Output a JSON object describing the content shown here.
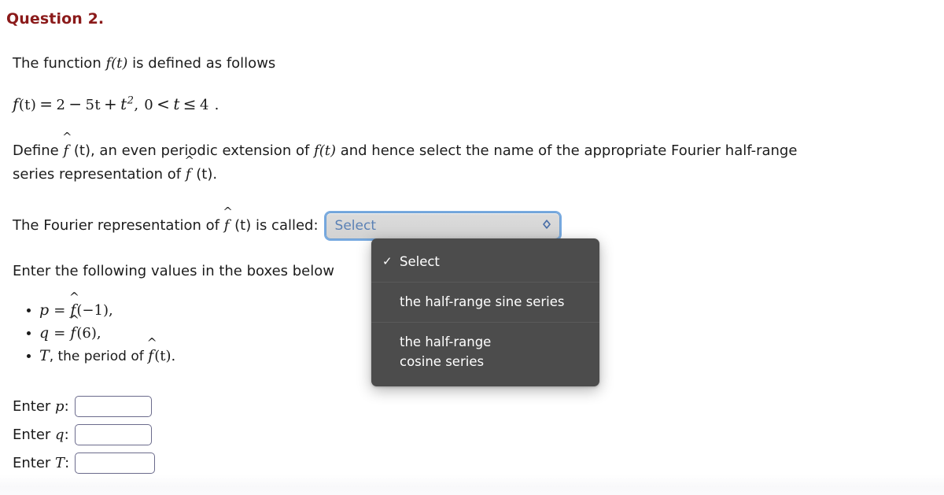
{
  "question": {
    "title": "Question 2."
  },
  "body": {
    "intro_prefix": "The function ",
    "intro_math": "f(t)",
    "intro_suffix": " is defined as follows",
    "formula": "f(t) = 2 − 5t + t², 0 < t ≤ 4 .",
    "formula_parts": {
      "lhs": "f",
      "arg": "(t)",
      "equals": "=",
      "term1": "2",
      "minus": "−",
      "term2": "5t",
      "plus": "+",
      "term3": "t",
      "exponent": "2",
      "comma": ",",
      "domain_low": "0",
      "lt": "<",
      "var": "t",
      "le": "≤",
      "domain_high": "4",
      "period": "."
    },
    "define_line_1": "Define f̂ (t), an even periodic extension of f(t) and hence select the name of the appropriate Fourier half-range",
    "define_line_2": "series representation of f̂ (t).",
    "define_segments": {
      "s1": "Define ",
      "s2": " (t), an even periodic extension of ",
      "s3": "f(t)",
      "s4": " and hence select the name of the appropriate Fourier half-range",
      "s5": "series representation of ",
      "s6": " (t)."
    },
    "fourier_prompt_prefix": "The Fourier representation of ",
    "fourier_prompt_suffix": " (t) is called:",
    "enter_values_line": "Enter the following values in the boxes below"
  },
  "bullets": [
    {
      "symbol": "p",
      "equals": "=",
      "fn": "f̂",
      "arg": "(−1),",
      "trailing": ""
    },
    {
      "symbol": "q",
      "equals": "=",
      "fn": "f̂",
      "arg": "(6),",
      "trailing": ""
    },
    {
      "symbol": "T",
      "equals": "",
      "fn": "f̂",
      "arg": "(t).",
      "trailing": ", the period of "
    }
  ],
  "select": {
    "name": "fourier-representation-select",
    "value": "Select",
    "icon": "stepper-updown-icon",
    "options": [
      {
        "label": "Select",
        "selected": true,
        "check": "✓"
      },
      {
        "label": "the half-range sine series",
        "selected": false,
        "check": ""
      },
      {
        "label": "the half-range cosine series",
        "selected": false,
        "check": "",
        "line1": "the half-range",
        "line2": "cosine series"
      }
    ]
  },
  "entries": [
    {
      "label_prefix": "Enter ",
      "label_var": "p",
      "label_colon": ":",
      "value": "",
      "placeholder": ""
    },
    {
      "label_prefix": "Enter ",
      "label_var": "q",
      "label_colon": ":",
      "value": "",
      "placeholder": ""
    },
    {
      "label_prefix": "Enter ",
      "label_var": "T",
      "label_colon": ":",
      "value": "",
      "placeholder": ""
    }
  ],
  "colors": {
    "title_red": "#8b1a1a",
    "text": "#1c1c1c",
    "select_focus_ring": "#609bdb",
    "select_value_blue": "#5b81b5",
    "dropdown_bg": "#4c4c4c",
    "input_border": "#6b6b8c"
  }
}
